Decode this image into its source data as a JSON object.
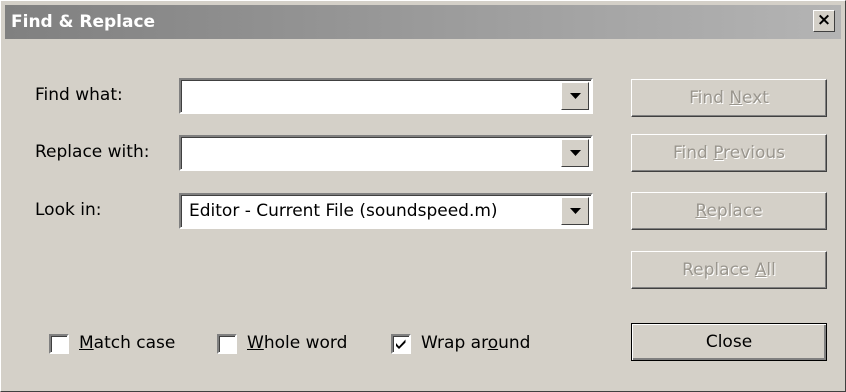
{
  "window": {
    "title": "Find & Replace",
    "close_glyph": "×"
  },
  "labels": {
    "find_what": "Find what:",
    "replace_with": "Replace with:",
    "look_in": "Look in:"
  },
  "fields": {
    "find_value": "",
    "replace_value": "",
    "look_in_value": "Editor - Current File (soundspeed.m)"
  },
  "buttons": {
    "find_next": {
      "pre": "Find ",
      "key": "N",
      "post": "ext",
      "enabled": false
    },
    "find_previous": {
      "pre": "Find ",
      "key": "P",
      "post": "revious",
      "enabled": false
    },
    "replace": {
      "pre": "",
      "key": "R",
      "post": "eplace",
      "enabled": false
    },
    "replace_all": {
      "pre": "Replace ",
      "key": "A",
      "post": "ll",
      "enabled": false
    },
    "close": {
      "label": "Close",
      "enabled": true
    }
  },
  "options": {
    "match_case": {
      "pre": "",
      "key": "M",
      "post": "atch case",
      "checked": false
    },
    "whole_word": {
      "pre": "",
      "key": "W",
      "post": "hole word",
      "checked": false
    },
    "wrap_around": {
      "pre": "Wrap ar",
      "key": "o",
      "post": "und",
      "checked": true
    }
  },
  "icons": {
    "dropdown": "triangle-down-icon",
    "check": "checkmark-icon"
  }
}
